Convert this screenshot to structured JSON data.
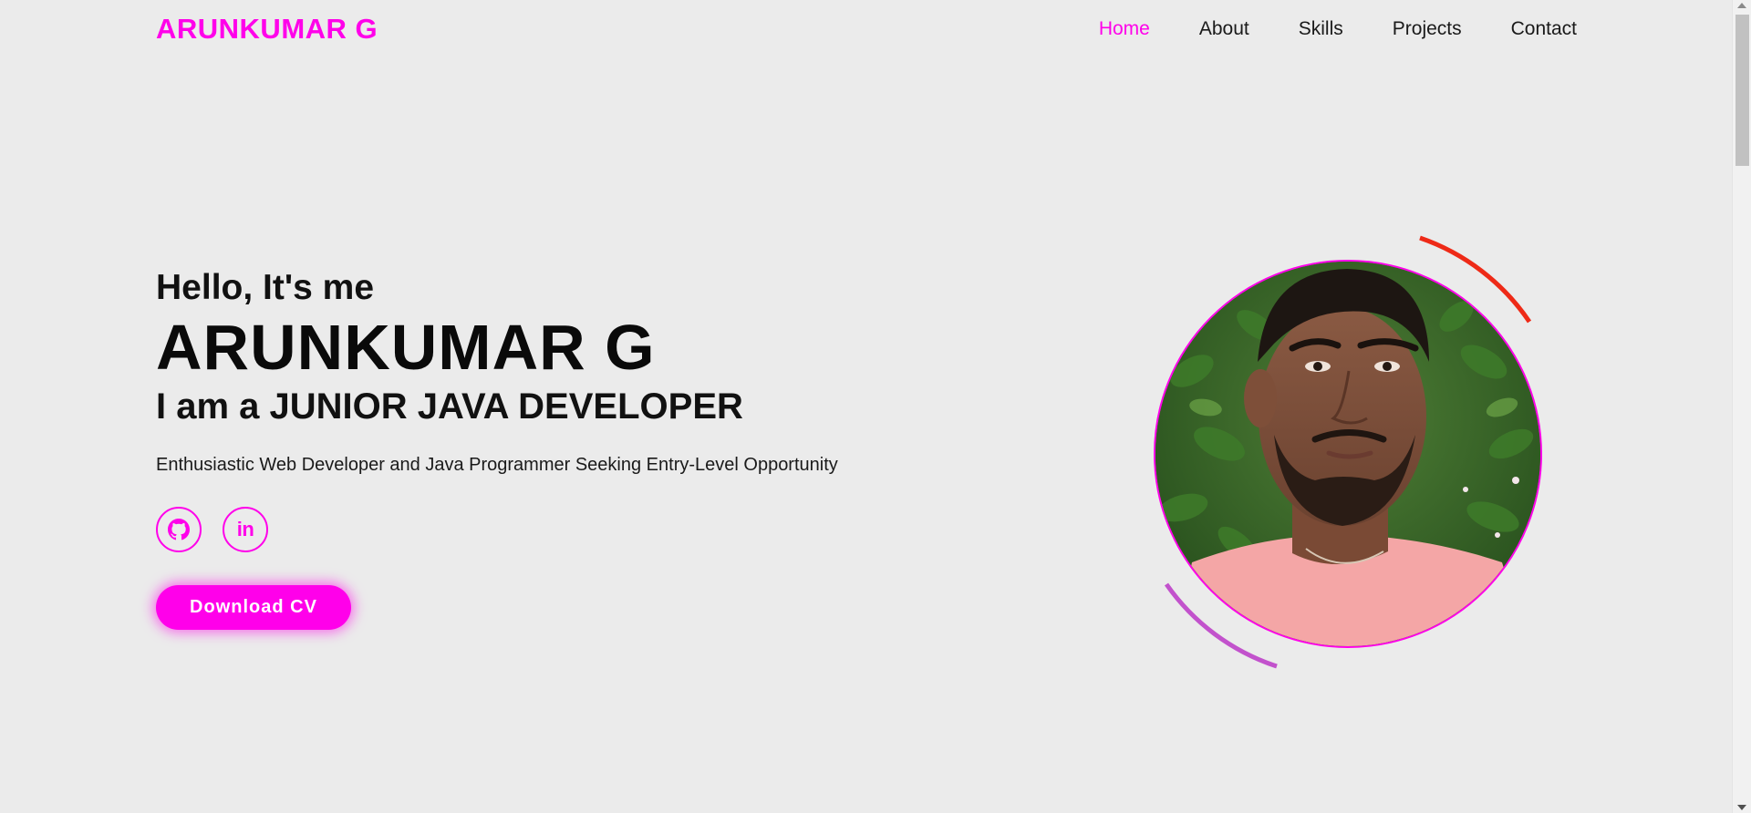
{
  "header": {
    "logo": "ARUNKUMAR G",
    "nav": [
      {
        "label": "Home",
        "active": true
      },
      {
        "label": "About",
        "active": false
      },
      {
        "label": "Skills",
        "active": false
      },
      {
        "label": "Projects",
        "active": false
      },
      {
        "label": "Contact",
        "active": false
      }
    ]
  },
  "hero": {
    "greeting": "Hello, It's me",
    "name": "ARUNKUMAR G",
    "role_prefix": "I am a",
    "role": "JUNIOR JAVA DEVELOPER",
    "tagline": "Enthusiastic Web Developer and Java Programmer Seeking Entry-Level Opportunity",
    "socials": [
      {
        "icon": "github-icon"
      },
      {
        "icon": "linkedin-icon",
        "text": "in"
      }
    ],
    "cv_button": "Download CV"
  },
  "colors": {
    "accent": "#ff00ea",
    "background": "#ebebeb",
    "arc_top": "#ee2a17",
    "arc_bottom": "#c252cc"
  }
}
